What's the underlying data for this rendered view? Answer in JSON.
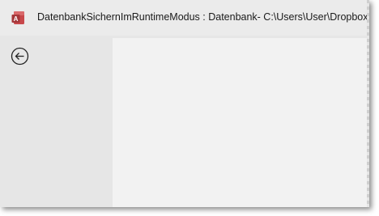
{
  "window": {
    "title": "DatenbankSichernImRuntimeModus : Datenbank- C:\\Users\\User\\Dropbox\\Date",
    "app_icon": "access-icon",
    "accent_color": "#a4373a"
  },
  "sidebar": {
    "back_icon": "back-arrow-icon"
  },
  "content": {}
}
